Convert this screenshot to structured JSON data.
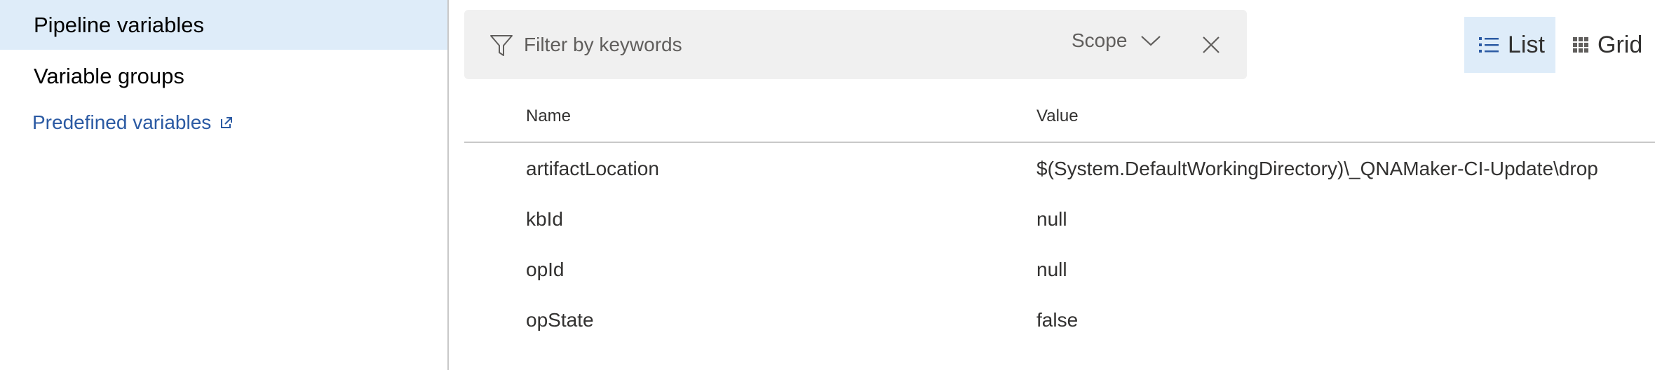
{
  "nav": {
    "items": [
      {
        "label": "Pipeline variables"
      },
      {
        "label": "Variable groups"
      }
    ],
    "link": {
      "label": "Predefined variables"
    }
  },
  "filter": {
    "placeholder": "Filter by keywords",
    "scope_label": "Scope"
  },
  "views": {
    "list_label": "List",
    "grid_label": "Grid"
  },
  "table": {
    "columns": [
      "Name",
      "Value"
    ],
    "rows": [
      {
        "name": "artifactLocation",
        "value": "$(System.DefaultWorkingDirectory)\\_QNAMaker-CI-Update\\drop"
      },
      {
        "name": "kbId",
        "value": "null"
      },
      {
        "name": "opId",
        "value": "null"
      },
      {
        "name": "opState",
        "value": "false"
      }
    ]
  },
  "colors": {
    "selected_bg": "#deecf9",
    "link": "#2b5aa3",
    "filter_bg": "#f0f0f0",
    "accent_icon": "#2b5aa3"
  },
  "icons": {
    "filter": "filter-icon",
    "chevron": "chevron-down-icon",
    "close": "close-icon",
    "external": "external-link-icon",
    "list": "list-icon",
    "grid": "grid-icon"
  }
}
